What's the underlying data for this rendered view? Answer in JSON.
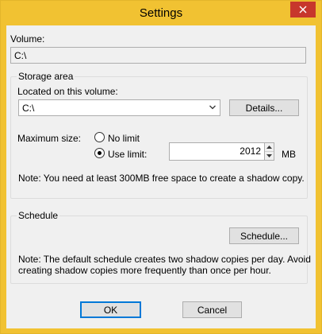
{
  "window": {
    "title": "Settings",
    "close_icon": "close-icon"
  },
  "volume": {
    "label": "Volume:",
    "value": "C:\\"
  },
  "storage_area": {
    "caption": "Storage area",
    "located_label": "Located on this volume:",
    "located_value": "C:\\",
    "details_button": "Details...",
    "max_size_label": "Maximum size:",
    "no_limit_label": "No limit",
    "use_limit_label": "Use limit:",
    "selected_option": "use_limit",
    "limit_value": "2012",
    "unit": "MB",
    "note": "Note: You need at least 300MB free space to create a shadow copy."
  },
  "schedule": {
    "caption": "Schedule",
    "button": "Schedule...",
    "note_line1": "Note: The default schedule creates two shadow copies per day. Avoid",
    "note_line2": "creating shadow copies more frequently than once per hour."
  },
  "footer": {
    "ok": "OK",
    "cancel": "Cancel"
  },
  "colors": {
    "titlebar": "#f1c232",
    "close_button": "#c7372c",
    "focus_accent": "#0078d7",
    "dialog_bg": "#f0f0f0"
  }
}
